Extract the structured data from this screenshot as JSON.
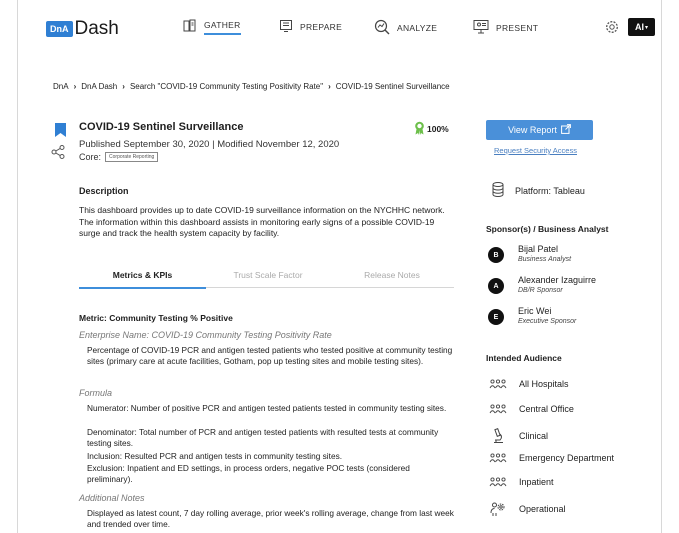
{
  "header": {
    "logo_badge": "DnA",
    "logo_text": "Dash",
    "nav": [
      {
        "label": "GATHER",
        "icon": "book-icon",
        "active": true
      },
      {
        "label": "PREPARE",
        "icon": "monitor-list-icon",
        "active": false
      },
      {
        "label": "ANALYZE",
        "icon": "magnify-chart-icon",
        "active": false
      },
      {
        "label": "PRESENT",
        "icon": "presentation-icon",
        "active": false
      }
    ],
    "user_initials": "AI"
  },
  "breadcrumb": [
    "DnA",
    "DnA Dash",
    "Search \"COVID-19 Community Testing Positivity Rate\"",
    "COVID-19 Sentinel Surveillance"
  ],
  "report": {
    "title": "COVID-19 Sentinel Surveillance",
    "meta": "Published September 30, 2020 | Modified November 12, 2020",
    "core_label": "Core:",
    "core_tag": "Corporate Reporting",
    "score": "100%",
    "description_heading": "Description",
    "description": "This dashboard provides up to date COVID-19 surveillance information on the NYCHHC network. The information within this dashboard assists in monitoring early signs of a possible COVID-19 surge and track the health system capacity by facility."
  },
  "tabs": [
    {
      "label": "Metrics & KPIs",
      "active": true
    },
    {
      "label": "Trust Scale Factor",
      "active": false
    },
    {
      "label": "Release Notes",
      "active": false
    }
  ],
  "metric": {
    "heading": "Metric: Community Testing % Positive",
    "enterprise_name": "Enterprise Name: COVID-19 Community Testing Positivity Rate",
    "enterprise_text": "Percentage of COVID-19 PCR and antigen tested patients who tested positive at community testing sites (primary care at acute facilities, Gotham, pop up testing sites and mobile testing sites).",
    "formula_label": "Formula",
    "numerator": "Numerator: Number of positive PCR and antigen tested patients tested in community testing sites.",
    "denominator": "Denominator: Total number of PCR and antigen tested patients with resulted tests at community testing sites.",
    "inclusion": "Inclusion: Resulted PCR and antigen tests in community testing sites.",
    "exclusion": "Exclusion: Inpatient and ED settings, in process orders, negative POC tests (considered preliminary).",
    "notes_label": "Additional Notes",
    "notes_text": "Displayed as latest count, 7 day rolling average, prior week's rolling average, change from last week and trended over time."
  },
  "sidebar": {
    "view_button": "View Report",
    "request_link": "Request Security Access",
    "platform": "Platform: Tableau",
    "sponsors_heading": "Sponsor(s) / Business Analyst",
    "sponsors": [
      {
        "initial": "B",
        "name": "Bijal Patel",
        "role": "Business Analyst"
      },
      {
        "initial": "A",
        "name": "Alexander Izaguirre",
        "role": "DB/R Sponsor"
      },
      {
        "initial": "E",
        "name": "Eric Wei",
        "role": "Executive Sponsor"
      }
    ],
    "audience_heading": "Intended Audience",
    "audience": [
      {
        "label": "All Hospitals",
        "icon": "people-group-icon"
      },
      {
        "label": "Central Office",
        "icon": "people-group-icon"
      },
      {
        "label": "Clinical",
        "icon": "microscope-icon"
      },
      {
        "label": "Emergency Department",
        "icon": "people-group-icon"
      },
      {
        "label": "Inpatient",
        "icon": "people-group-icon"
      },
      {
        "label": "Operational",
        "icon": "person-gear-icon"
      }
    ]
  },
  "colors": {
    "accent": "#4a90d9",
    "tab_underline": "#3e8edb",
    "bookmark": "#2f7fd3",
    "ribbon": "#6cbf4a"
  }
}
